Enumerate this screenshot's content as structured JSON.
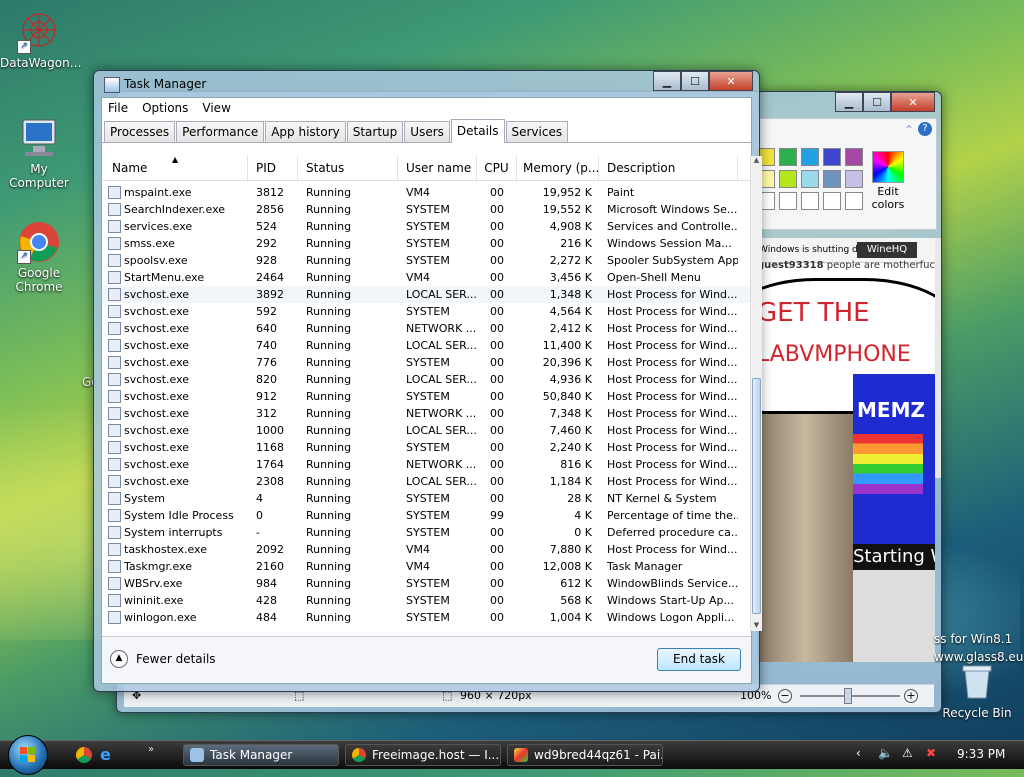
{
  "desktop": {
    "icons": [
      {
        "label": "DataWagon…"
      },
      {
        "label": "My Computer"
      },
      {
        "label": "Google Chrome"
      },
      {
        "label": "Recycle Bin"
      }
    ],
    "partial_labels": {
      "go": "Go",
      "glass_line1": "ss for Win8.1",
      "glass_line2": "www.glass8.eu"
    }
  },
  "task_manager": {
    "title": "Task Manager",
    "menu": [
      "File",
      "Options",
      "View"
    ],
    "tabs": [
      "Processes",
      "Performance",
      "App history",
      "Startup",
      "Users",
      "Details",
      "Services"
    ],
    "active_tab": "Details",
    "columns": [
      "Name",
      "PID",
      "Status",
      "User name",
      "CPU",
      "Memory (p...",
      "Description"
    ],
    "rows": [
      {
        "name": "mspaint.exe",
        "pid": "3812",
        "status": "Running",
        "user": "VM4",
        "cpu": "00",
        "mem": "19,952 K",
        "desc": "Paint"
      },
      {
        "name": "SearchIndexer.exe",
        "pid": "2856",
        "status": "Running",
        "user": "SYSTEM",
        "cpu": "00",
        "mem": "19,552 K",
        "desc": "Microsoft Windows Se..."
      },
      {
        "name": "services.exe",
        "pid": "524",
        "status": "Running",
        "user": "SYSTEM",
        "cpu": "00",
        "mem": "4,908 K",
        "desc": "Services and Controlle..."
      },
      {
        "name": "smss.exe",
        "pid": "292",
        "status": "Running",
        "user": "SYSTEM",
        "cpu": "00",
        "mem": "216 K",
        "desc": "Windows Session Ma..."
      },
      {
        "name": "spoolsv.exe",
        "pid": "928",
        "status": "Running",
        "user": "SYSTEM",
        "cpu": "00",
        "mem": "2,272 K",
        "desc": "Spooler SubSystem App"
      },
      {
        "name": "StartMenu.exe",
        "pid": "2464",
        "status": "Running",
        "user": "VM4",
        "cpu": "00",
        "mem": "3,456 K",
        "desc": "Open-Shell Menu"
      },
      {
        "name": "svchost.exe",
        "pid": "3892",
        "status": "Running",
        "user": "LOCAL SER...",
        "cpu": "00",
        "mem": "1,348 K",
        "desc": "Host Process for Wind..."
      },
      {
        "name": "svchost.exe",
        "pid": "592",
        "status": "Running",
        "user": "SYSTEM",
        "cpu": "00",
        "mem": "4,564 K",
        "desc": "Host Process for Wind..."
      },
      {
        "name": "svchost.exe",
        "pid": "640",
        "status": "Running",
        "user": "NETWORK ...",
        "cpu": "00",
        "mem": "2,412 K",
        "desc": "Host Process for Wind..."
      },
      {
        "name": "svchost.exe",
        "pid": "740",
        "status": "Running",
        "user": "LOCAL SER...",
        "cpu": "00",
        "mem": "11,400 K",
        "desc": "Host Process for Wind..."
      },
      {
        "name": "svchost.exe",
        "pid": "776",
        "status": "Running",
        "user": "SYSTEM",
        "cpu": "00",
        "mem": "20,396 K",
        "desc": "Host Process for Wind..."
      },
      {
        "name": "svchost.exe",
        "pid": "820",
        "status": "Running",
        "user": "LOCAL SER...",
        "cpu": "00",
        "mem": "4,936 K",
        "desc": "Host Process for Wind..."
      },
      {
        "name": "svchost.exe",
        "pid": "912",
        "status": "Running",
        "user": "SYSTEM",
        "cpu": "00",
        "mem": "50,840 K",
        "desc": "Host Process for Wind..."
      },
      {
        "name": "svchost.exe",
        "pid": "312",
        "status": "Running",
        "user": "NETWORK ...",
        "cpu": "00",
        "mem": "7,348 K",
        "desc": "Host Process for Wind..."
      },
      {
        "name": "svchost.exe",
        "pid": "1000",
        "status": "Running",
        "user": "LOCAL SER...",
        "cpu": "00",
        "mem": "7,460 K",
        "desc": "Host Process for Wind..."
      },
      {
        "name": "svchost.exe",
        "pid": "1168",
        "status": "Running",
        "user": "SYSTEM",
        "cpu": "00",
        "mem": "2,240 K",
        "desc": "Host Process for Wind..."
      },
      {
        "name": "svchost.exe",
        "pid": "1764",
        "status": "Running",
        "user": "NETWORK ...",
        "cpu": "00",
        "mem": "816 K",
        "desc": "Host Process for Wind..."
      },
      {
        "name": "svchost.exe",
        "pid": "2308",
        "status": "Running",
        "user": "LOCAL SER...",
        "cpu": "00",
        "mem": "1,184 K",
        "desc": "Host Process for Wind..."
      },
      {
        "name": "System",
        "pid": "4",
        "status": "Running",
        "user": "SYSTEM",
        "cpu": "00",
        "mem": "28 K",
        "desc": "NT Kernel & System"
      },
      {
        "name": "System Idle Process",
        "pid": "0",
        "status": "Running",
        "user": "SYSTEM",
        "cpu": "99",
        "mem": "4 K",
        "desc": "Percentage of time the..."
      },
      {
        "name": "System interrupts",
        "pid": "-",
        "status": "Running",
        "user": "SYSTEM",
        "cpu": "00",
        "mem": "0 K",
        "desc": "Deferred procedure ca..."
      },
      {
        "name": "taskhostex.exe",
        "pid": "2092",
        "status": "Running",
        "user": "VM4",
        "cpu": "00",
        "mem": "7,880 K",
        "desc": "Host Process for Wind..."
      },
      {
        "name": "Taskmgr.exe",
        "pid": "2160",
        "status": "Running",
        "user": "VM4",
        "cpu": "00",
        "mem": "12,008 K",
        "desc": "Task Manager"
      },
      {
        "name": "WBSrv.exe",
        "pid": "984",
        "status": "Running",
        "user": "SYSTEM",
        "cpu": "00",
        "mem": "612 K",
        "desc": "WindowBlinds Service..."
      },
      {
        "name": "wininit.exe",
        "pid": "428",
        "status": "Running",
        "user": "SYSTEM",
        "cpu": "00",
        "mem": "568 K",
        "desc": "Windows Start-Up Ap..."
      },
      {
        "name": "winlogon.exe",
        "pid": "484",
        "status": "Running",
        "user": "SYSTEM",
        "cpu": "00",
        "mem": "1,004 K",
        "desc": "Windows Logon Appli..."
      }
    ],
    "fewer_details": "Fewer details",
    "end_task": "End task"
  },
  "paint": {
    "edit_colors": "Edit colors",
    "dimensions": "960 × 720px",
    "zoom": "100%",
    "canvas": {
      "winehq": "WineHQ",
      "shutdown": "Windows is shutting down...",
      "user": "guest93318",
      "tagline": "people are motherfuckers",
      "get_the": "GET THE",
      "labvmphone": "LABVMPHONE",
      "memz": "MEMZ",
      "starting": "Starting W"
    },
    "swatches": [
      "#f2e23b",
      "#2db04b",
      "#22a1e4",
      "#3f48cc",
      "#a349a4",
      "#fef9a8",
      "#b5e61d",
      "#99d9ea",
      "#7092be",
      "#c8bfe7",
      "#ffffff",
      "#ffffff",
      "#ffffff",
      "#ffffff",
      "#ffffff"
    ]
  },
  "taskbar": {
    "buttons": [
      "Task Manager",
      "Freeimage.host — I...",
      "wd9bred44qz61 - Pai..."
    ],
    "clock": "9:33 PM"
  }
}
